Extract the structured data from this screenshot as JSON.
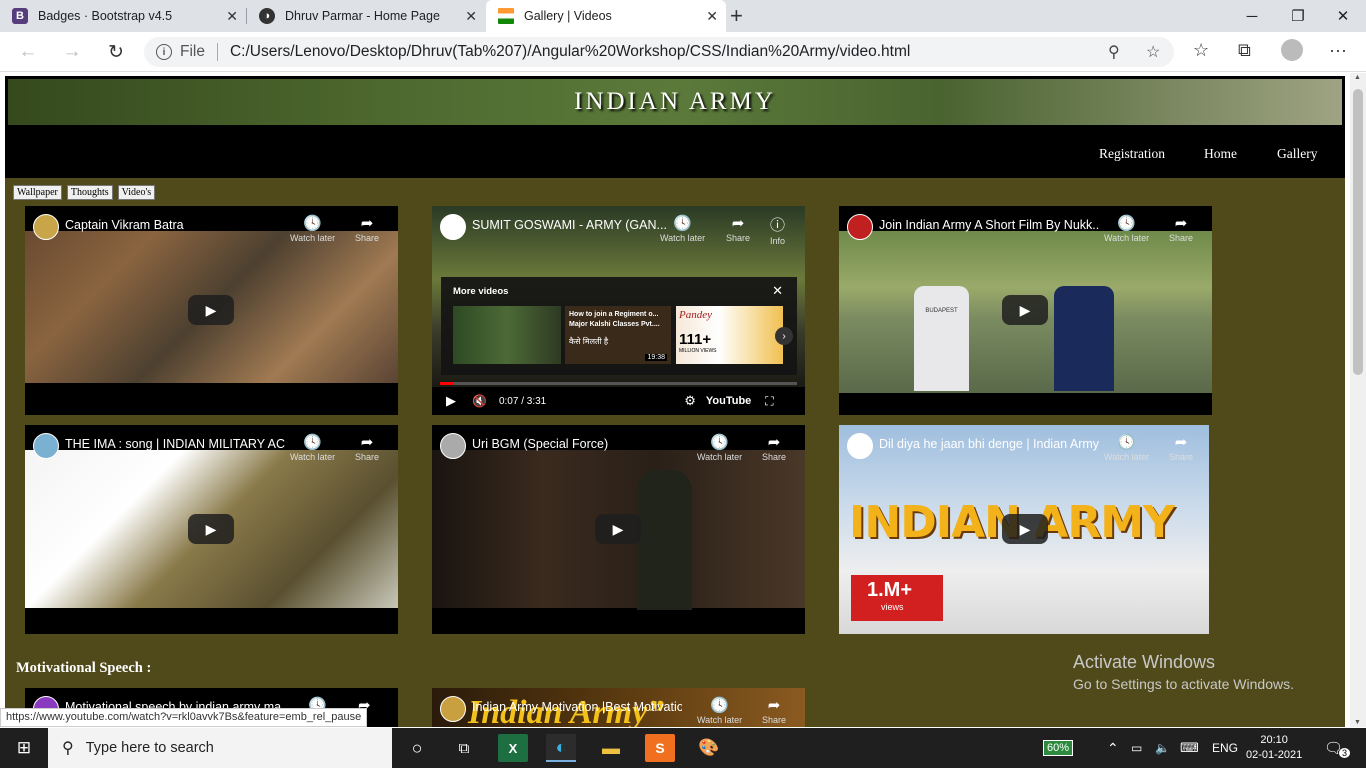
{
  "browser": {
    "tabs": [
      {
        "label": "Badges · Bootstrap v4.5",
        "favicon": "B",
        "color": "#563d7c"
      },
      {
        "label": "Dhruv Parmar - Home Page",
        "favicon": "◑",
        "color": "#333333"
      },
      {
        "label": "Gallery | Videos",
        "favicon": "flag-icon",
        "color": "#ff9933"
      }
    ],
    "file_label": "File",
    "url": "C:/Users/Lenovo/Desktop/Dhruv(Tab%207)/Angular%20Workshop/CSS/Indian%20Army/video.html"
  },
  "site": {
    "title": "INDIAN ARMY",
    "nav": [
      "Registration",
      "Home",
      "Gallery"
    ],
    "subtabs": [
      "Wallpaper",
      "Thoughts",
      "Video's"
    ],
    "section_heading": "Motivational Speech :"
  },
  "actions": {
    "watch_later": "Watch later",
    "share": "Share",
    "info": "Info"
  },
  "videos": [
    {
      "title": "Captain Vikram Batra"
    },
    {
      "title": "SUMIT GOSWAMI - ARMY (GAN...",
      "more_videos": "More videos",
      "more1": "How to join a Regiment o... Major Kalshi Classes Pvt....",
      "more1_text": "कैसे मिलती है",
      "more1_duration": "19:38",
      "more2_big": "111+",
      "more2_small": "MILLION VIEWS",
      "more2_brand": "Pandey",
      "time": "0:07 / 3:31",
      "youtube": "YouTube"
    },
    {
      "title": "Join Indian Army A Short Film By Nukk...",
      "shirt": "BUDAPEST"
    },
    {
      "title": "THE IMA : song | INDIAN MILITARY AC..."
    },
    {
      "title": "Uri BGM (Special Force)"
    },
    {
      "title": "Dil diya he jaan bhi denge | Indian Army...",
      "overlay": "INDIAN ARMY",
      "badge": "1.M+",
      "badge_sub": "views"
    },
    {
      "title": "Motivational speech by indian army ma..."
    },
    {
      "title": "Indian Army Motivation |Best Motivatio...",
      "overlay": "Indian Army”"
    }
  ],
  "status_url": "https://www.youtube.com/watch?v=rkl0avvk7Bs&feature=emb_rel_pause",
  "activate": {
    "title": "Activate Windows",
    "sub": "Go to Settings to activate Windows."
  },
  "taskbar": {
    "search_placeholder": "Type here to search",
    "battery": "60%",
    "lang": "ENG",
    "time": "20:10",
    "date": "02-01-2021",
    "notif": "3"
  }
}
